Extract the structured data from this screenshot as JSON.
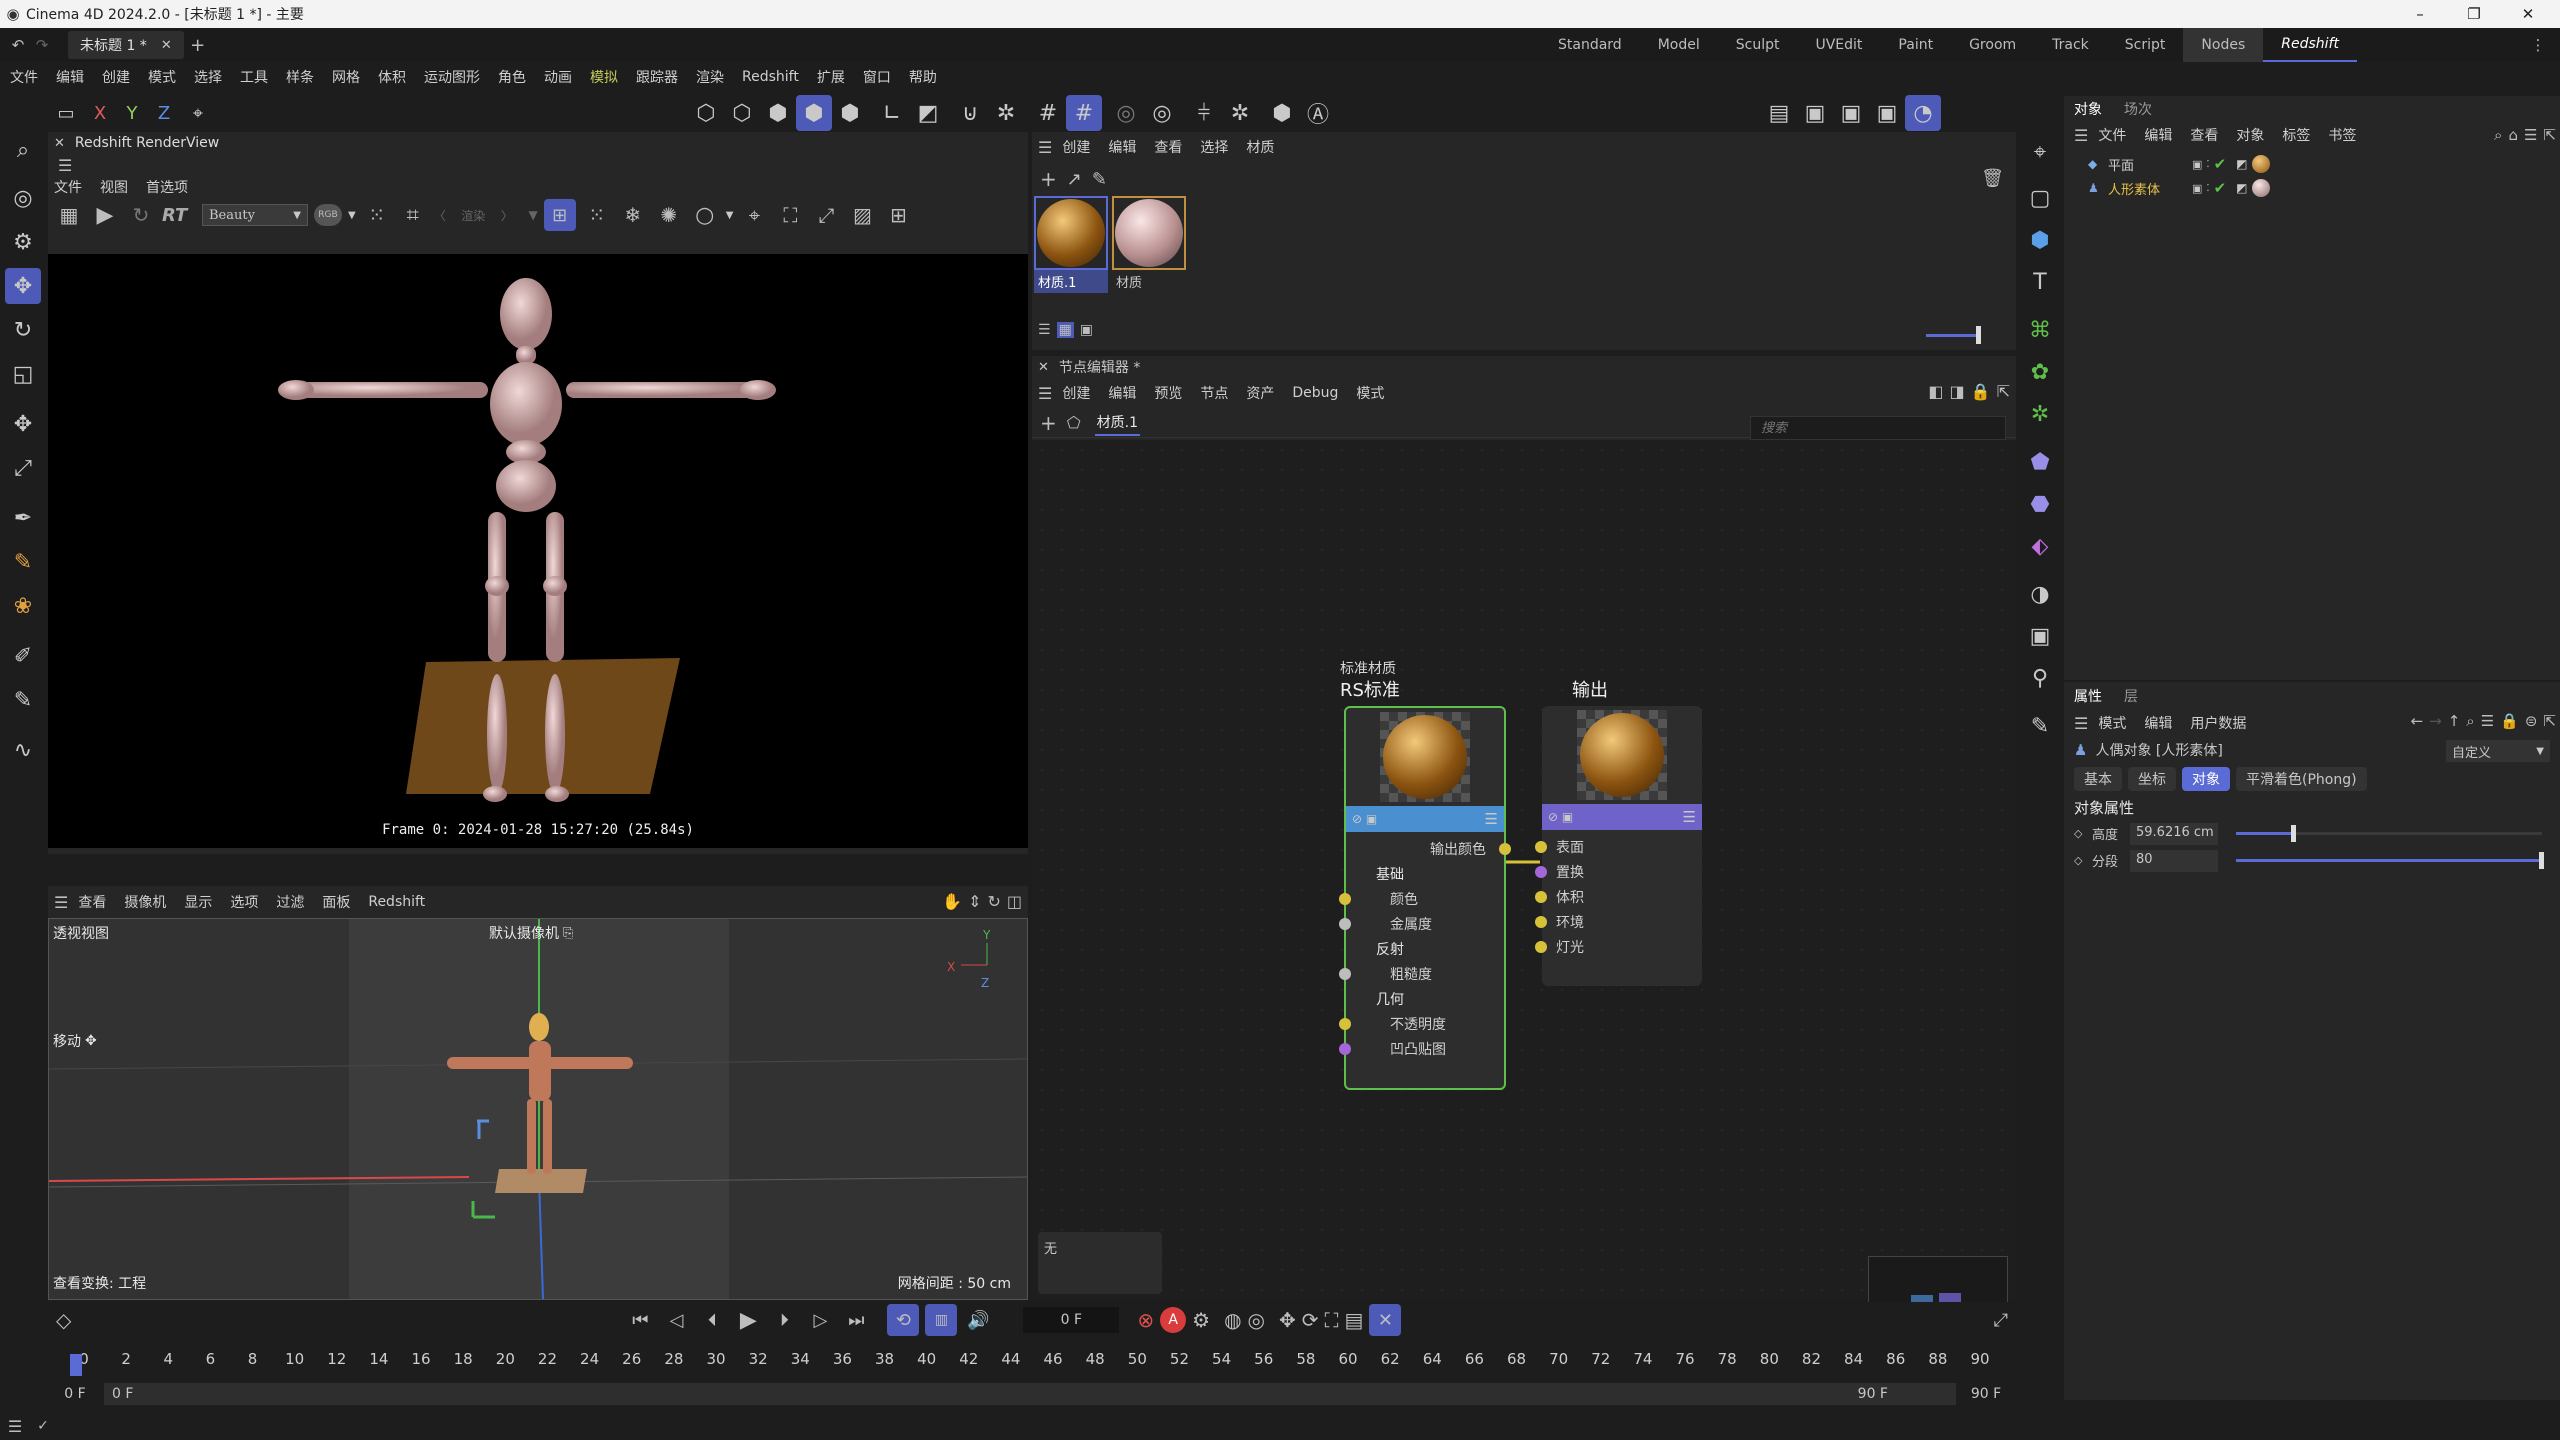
{
  "app": {
    "title": "Cinema 4D 2024.2.0 - [未标题 1 *] - 主要",
    "doc_tab": "未标题 1 *",
    "win_min": "–",
    "win_max": "❐",
    "win_close": "✕"
  },
  "layouts": [
    "Standard",
    "Model",
    "Sculpt",
    "UVEdit",
    "Paint",
    "Groom",
    "Track",
    "Script",
    "Nodes",
    "Redshift"
  ],
  "menus": [
    "文件",
    "编辑",
    "创建",
    "模式",
    "选择",
    "工具",
    "样条",
    "网格",
    "体积",
    "运动图形",
    "角色",
    "动画",
    "模拟",
    "跟踪器",
    "渲染",
    "Redshift",
    "扩展",
    "窗口",
    "帮助"
  ],
  "axis_labels": {
    "x": "X",
    "y": "Y",
    "z": "Z"
  },
  "renderview": {
    "title": "Redshift RenderView",
    "menus": [
      "文件",
      "视图",
      "首选项"
    ],
    "rt": "RT",
    "aov": "Beauty",
    "rgb": "RGB",
    "render_label": "渲染",
    "frame_info": "Frame  0:  2024-01-28  15:27:20  (25.84s)"
  },
  "viewport": {
    "menus": [
      "查看",
      "摄像机",
      "显示",
      "选项",
      "过滤",
      "面板",
      "Redshift"
    ],
    "name": "透视视图",
    "camera": "默认摄像机",
    "move": "移动",
    "transform": "查看变换: 工程",
    "grid": "网格间距 : 50 cm"
  },
  "material_manager": {
    "menus": [
      "创建",
      "编辑",
      "查看",
      "选择",
      "材质"
    ],
    "materials": [
      {
        "name": "材质.1",
        "selected": true
      },
      {
        "name": "材质",
        "selected": false
      }
    ]
  },
  "node_editor": {
    "title": "节点编辑器 *",
    "menus": [
      "创建",
      "编辑",
      "预览",
      "节点",
      "资产",
      "Debug",
      "模式"
    ],
    "tab": "材质.1",
    "search_placeholder": "搜索",
    "info": "无",
    "node_std": {
      "subtitle": "标准材质",
      "title": "RS标准",
      "output": "输出颜色",
      "groups": [
        {
          "name": "基础",
          "ports": [
            "颜色",
            "金属度"
          ]
        },
        {
          "name": "反射",
          "ports": [
            "粗糙度"
          ]
        },
        {
          "name": "几何",
          "ports": [
            "不透明度",
            "凹凸贴图"
          ]
        }
      ]
    },
    "node_out": {
      "title": "输出",
      "ports": [
        "表面",
        "置换",
        "体积",
        "环境",
        "灯光"
      ]
    }
  },
  "objects": {
    "tabs": [
      "对象",
      "场次"
    ],
    "menus": [
      "文件",
      "编辑",
      "查看",
      "对象",
      "标签",
      "书签"
    ],
    "items": [
      {
        "name": "平面",
        "color": "#cfcfcf"
      },
      {
        "name": "人形素体",
        "color": "#e8c34a"
      }
    ]
  },
  "attributes": {
    "tabs": [
      "属性",
      "层"
    ],
    "menus": [
      "模式",
      "编辑",
      "用户数据"
    ],
    "object_label": "人偶对象 [人形素体]",
    "preset": "自定义",
    "subtabs": [
      "基本",
      "坐标",
      "对象",
      "平滑着色(Phong)"
    ],
    "section": "对象属性",
    "fields": [
      {
        "label": "高度",
        "value": "59.6216 cm",
        "fraction": 0.19
      },
      {
        "label": "分段",
        "value": "80",
        "fraction": 1.0
      }
    ]
  },
  "timeline": {
    "current": "0 F",
    "start": "0 F",
    "range_start": "0 F",
    "range_end": "90 F",
    "end": "90 F",
    "ticks": [
      "0",
      "2",
      "4",
      "6",
      "8",
      "10",
      "12",
      "14",
      "16",
      "18",
      "20",
      "22",
      "24",
      "26",
      "28",
      "30",
      "32",
      "34",
      "36",
      "38",
      "40",
      "42",
      "44",
      "46",
      "48",
      "50",
      "52",
      "54",
      "56",
      "58",
      "60",
      "62",
      "64",
      "66",
      "68",
      "70",
      "72",
      "74",
      "76",
      "78",
      "80",
      "82",
      "84",
      "86",
      "88",
      "90"
    ]
  },
  "colors": {
    "accent": "#5b6bd6",
    "node_blue": "#4a8fd0",
    "node_purple": "#6f63c9",
    "green": "#5fbf4a",
    "port_yellow": "#d8c13a",
    "port_purple": "#a566d8"
  }
}
